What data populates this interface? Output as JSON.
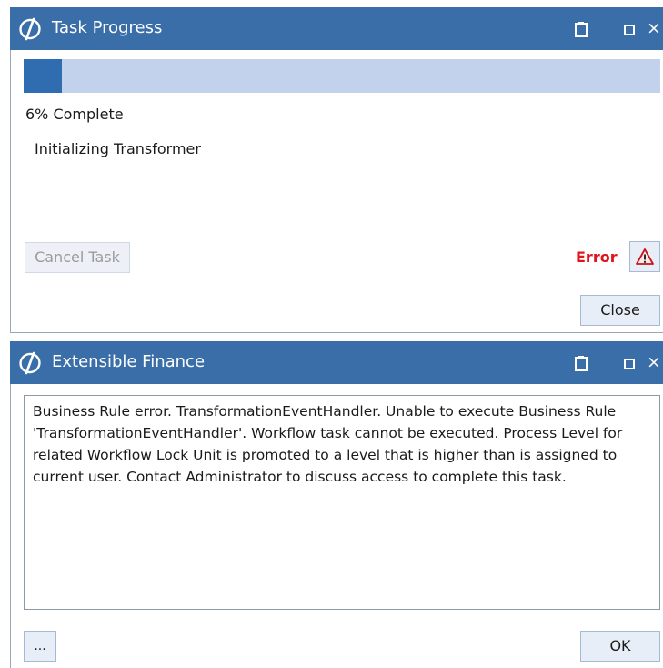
{
  "task_progress": {
    "title": "Task Progress",
    "progress_fraction": 0.06,
    "percent_label": "6% Complete",
    "status_text": "Initializing Transformer",
    "cancel_label": "Cancel Task",
    "error_label": "Error",
    "close_label": "Close"
  },
  "extensible_finance": {
    "title": "Extensible Finance",
    "message": "Business Rule error. TransformationEventHandler. Unable to execute Business Rule 'TransformationEventHandler'. Workflow task cannot be executed. Process Level for related Workflow Lock Unit is promoted to a level that is higher than is assigned to current user.  Contact Administrator to discuss access to complete this task.",
    "ellipsis_label": "...",
    "ok_label": "OK"
  },
  "window_controls": {
    "close_glyph": "×"
  },
  "icons": [
    "app-logo-icon",
    "clipboard-icon",
    "maximize-icon",
    "close-icon",
    "warning-icon"
  ],
  "colors": {
    "titlebar": "#3a6ea8",
    "progress_fill": "#2f6db0",
    "progress_track": "#c2d2ec",
    "error_text": "#e0141e"
  }
}
